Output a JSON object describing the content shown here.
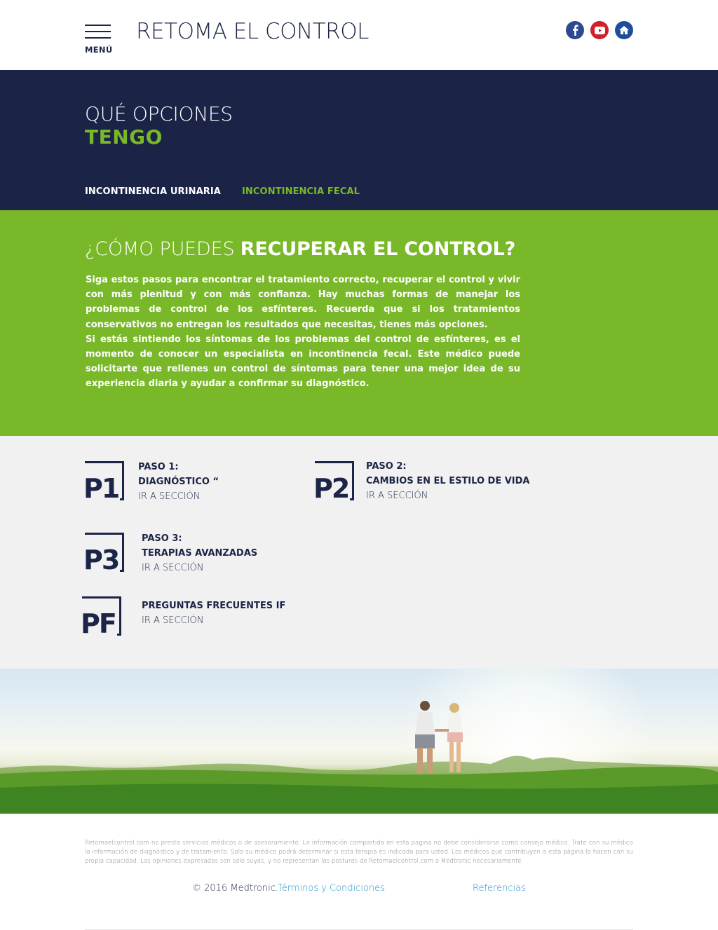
{
  "header": {
    "menu_label": "MENÚ",
    "site_title": "RETOMA EL CONTROL",
    "social": [
      {
        "icon": "facebook-icon",
        "color": "#2c4a8f"
      },
      {
        "icon": "youtube-icon",
        "color": "#d0202a"
      },
      {
        "icon": "home-icon",
        "color": "#1e4e9a"
      }
    ]
  },
  "hero": {
    "title_line1": "QUÉ OPCIONES",
    "title_line2": "TENGO",
    "tabs": [
      {
        "label": "INCONTINENCIA URINARIA",
        "active": false
      },
      {
        "label": "INCONTINENCIA FECAL",
        "active": true
      }
    ]
  },
  "section": {
    "heading_light": "¿CÓMO PUEDES ",
    "heading_bold": "RECUPERAR EL CONTROL?",
    "paragraph1": "Siga estos pasos para encontrar el tratamiento correcto, recuperar el control y vivir con más plenitud y con más confianza. Hay muchas formas de manejar los problemas de control de los esfínteres. Recuerda que si los tratamientos conservativos no entregan los resultados que necesitas, tienes más opciones.",
    "paragraph2": "Si estás sintiendo los síntomas de los problemas del control de esfínteres, es el momento de conocer un especialista en incontinencia fecal. Este médico puede solicitarte que rellenes un control de síntomas para tener una mejor idea de su experiencia diaria y ayudar a confirmar su diagnóstico."
  },
  "steps": [
    {
      "code": "P1",
      "kicker": "PASO 1:",
      "name": "DIAGNÓSTICO “",
      "link": "IR A SECCIÓN"
    },
    {
      "code": "P2",
      "kicker": "PASO 2:",
      "name": "CAMBIOS EN EL ESTILO DE VIDA",
      "link": "IR A SECCIÓN"
    },
    {
      "code": "P3",
      "kicker": "PASO 3:",
      "name": "TERAPIAS AVANZADAS",
      "link": "IR A SECCIÓN"
    },
    {
      "code": "PF",
      "kicker": "",
      "name": "PREGUNTAS FRECUENTES  IF",
      "link": "IR A SECCIÓN"
    }
  ],
  "footer": {
    "disclaimer": "Retomaelcontrol.com no presta servicios médicos o de asesoramiento. La información compartida en esta pagina no debe considerarse como consejo médico. Trate con su médico la información de diagnóstico y de tratamiento. Solo su médico podrá determinar si esta terapia es indicada para usted. Los médicos que contribuyen a esta página lo hacen con su propia capacidad. Las opiniones expresadas son solo suyas, y no representan las posturas de Retomaelcontrol.com o Medtronic necesariamente.",
    "copyright": "© 2016 Medtronic.",
    "terms": "Términos y Condiciones",
    "references": "Referencias"
  },
  "colors": {
    "navy": "#1b2446",
    "green": "#79b829",
    "grey": "#f1f1f1",
    "link_blue": "#1e8fc9"
  }
}
